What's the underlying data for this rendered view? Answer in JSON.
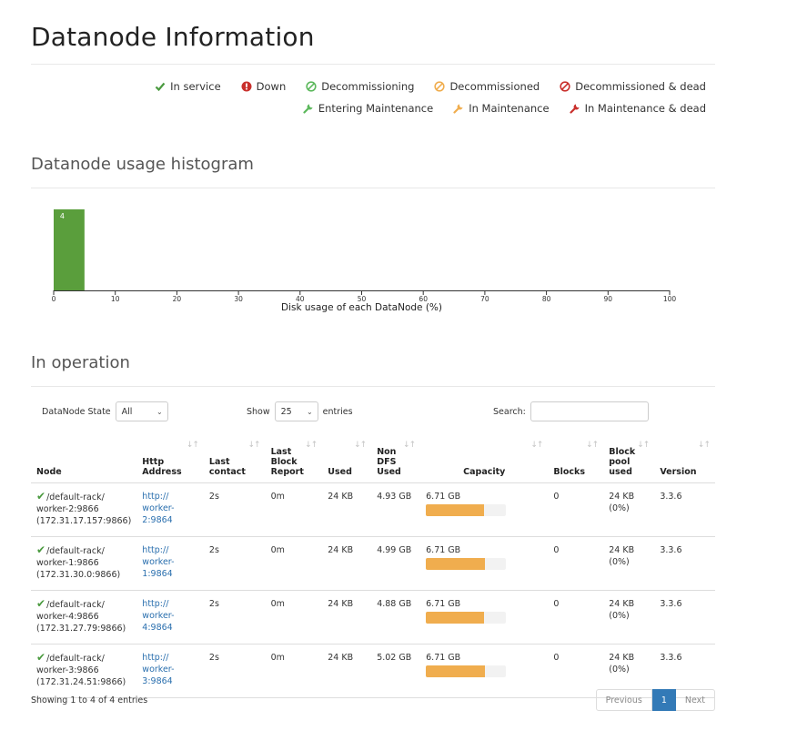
{
  "page": {
    "title": "Datanode Information"
  },
  "legend": {
    "row1": [
      {
        "icon": "check-icon",
        "label": "In service",
        "color": "#4a9a3f"
      },
      {
        "icon": "exclamation-circle-icon",
        "label": "Down",
        "color": "#c9302c"
      },
      {
        "icon": "ban-icon",
        "label": "Decommissioning",
        "color": "#5cb85c"
      },
      {
        "icon": "ban-icon",
        "label": "Decommissioned",
        "color": "#f0ad4e"
      },
      {
        "icon": "ban-icon",
        "label": "Decommissioned & dead",
        "color": "#c9302c"
      }
    ],
    "row2": [
      {
        "icon": "wrench-icon",
        "label": "Entering Maintenance",
        "color": "#5cb85c"
      },
      {
        "icon": "wrench-icon",
        "label": "In Maintenance",
        "color": "#f0ad4e"
      },
      {
        "icon": "wrench-icon",
        "label": "In Maintenance & dead",
        "color": "#c9302c"
      }
    ]
  },
  "histogram": {
    "heading": "Datanode usage histogram"
  },
  "chart_data": {
    "type": "bar",
    "categories": [
      "0-5"
    ],
    "values": [
      4
    ],
    "xlabel": "Disk usage of each DataNode (%)",
    "xlim": [
      0,
      100
    ],
    "xticks": [
      0,
      10,
      20,
      30,
      40,
      50,
      60,
      70,
      80,
      90,
      100
    ],
    "bins": [
      {
        "start": 0,
        "end": 5,
        "count": 4
      }
    ],
    "bar_color": "#5a9e3c"
  },
  "operation": {
    "heading": "In operation",
    "state_label": "DataNode State",
    "state_value": "All",
    "show_label": "Show",
    "show_value": "25",
    "entries_label": "entries",
    "search_label": "Search:",
    "search_value": ""
  },
  "table": {
    "columns": [
      "Node",
      "Http Address",
      "Last contact",
      "Last Block Report",
      "Used",
      "Non DFS Used",
      "Capacity",
      "Blocks",
      "Block pool used",
      "Version"
    ],
    "rows": [
      {
        "node": "/default-rack/",
        "node2": "worker-2:9866",
        "node3": "(172.31.17.157:9866)",
        "http": "http://",
        "http2": "worker-2:9864",
        "contact": "2s",
        "report": "0m",
        "used": "24 KB",
        "nondfs": "4.93 GB",
        "capacity": "6.71 GB",
        "cap_pct": 73,
        "blocks": "0",
        "bpool": "24 KB",
        "bpool2": "(0%)",
        "version": "3.3.6"
      },
      {
        "node": "/default-rack/",
        "node2": "worker-1:9866",
        "node3": "(172.31.30.0:9866)",
        "http": "http://",
        "http2": "worker-1:9864",
        "contact": "2s",
        "report": "0m",
        "used": "24 KB",
        "nondfs": "4.99 GB",
        "capacity": "6.71 GB",
        "cap_pct": 74,
        "blocks": "0",
        "bpool": "24 KB",
        "bpool2": "(0%)",
        "version": "3.3.6"
      },
      {
        "node": "/default-rack/",
        "node2": "worker-4:9866",
        "node3": "(172.31.27.79:9866)",
        "http": "http://",
        "http2": "worker-4:9864",
        "contact": "2s",
        "report": "0m",
        "used": "24 KB",
        "nondfs": "4.88 GB",
        "capacity": "6.71 GB",
        "cap_pct": 73,
        "blocks": "0",
        "bpool": "24 KB",
        "bpool2": "(0%)",
        "version": "3.3.6"
      },
      {
        "node": "/default-rack/",
        "node2": "worker-3:9866",
        "node3": "(172.31.24.51:9866)",
        "http": "http://",
        "http2": "worker-3:9864",
        "contact": "2s",
        "report": "0m",
        "used": "24 KB",
        "nondfs": "5.02 GB",
        "capacity": "6.71 GB",
        "cap_pct": 74,
        "blocks": "0",
        "bpool": "24 KB",
        "bpool2": "(0%)",
        "version": "3.3.6"
      }
    ]
  },
  "footer": {
    "info": "Showing 1 to 4 of 4 entries",
    "prev": "Previous",
    "page": "1",
    "next": "Next"
  }
}
